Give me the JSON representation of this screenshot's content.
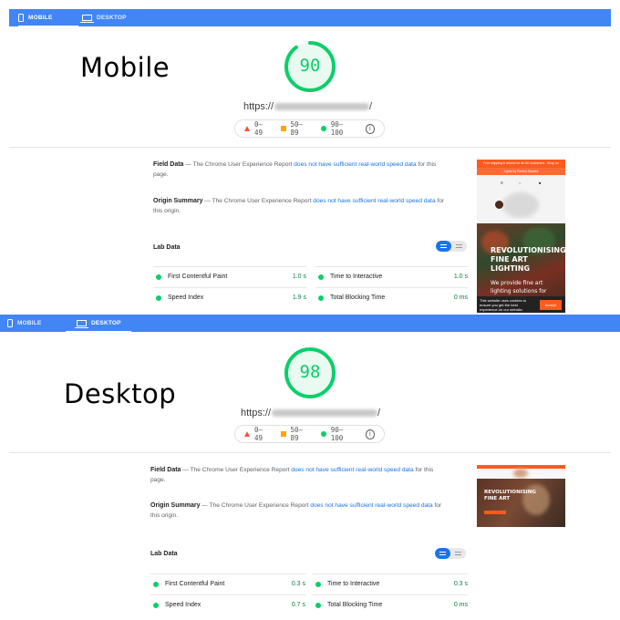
{
  "tabs": {
    "mobile": "MOBILE",
    "desktop": "DESKTOP"
  },
  "legend": {
    "low": "0–49",
    "mid": "50–89",
    "high": "90–100",
    "info_icon": "info-icon"
  },
  "colors": {
    "tab_bar": "#4285f4",
    "pass": "#0cce6b",
    "average": "#ffa400",
    "fail": "#ff4e42",
    "link": "#1a73e8",
    "brand_orange": "#ff5a1f"
  },
  "field_data": {
    "title": "Field Data",
    "text": " — The Chrome User Experience Report ",
    "link": "does not have sufficient real-world speed data",
    "tail": " for this page."
  },
  "origin_summary": {
    "title": "Origin Summary",
    "text": " — The Chrome User Experience Report ",
    "link": "does not have sufficient real-world speed data",
    "tail": " for this origin."
  },
  "lab_title": "Lab Data",
  "metric_names": {
    "fcp": "First Contentful Paint",
    "tti": "Time to Interactive",
    "si": "Speed Index",
    "tbt": "Total Blocking Time"
  },
  "mobile": {
    "label": "Mobile",
    "score": "90",
    "score_fraction": 0.9,
    "url_prefix": "https://",
    "url_suffix": "/",
    "metrics": {
      "fcp": "1.0 s",
      "tti": "1.0 s",
      "si": "1.9 s",
      "tbt": "0 ms"
    },
    "thumbnail": {
      "top_bar": "Free shipping & returns for all UK customers - Shop no",
      "sub_bar": "Lights by Perfect Shades",
      "headline": [
        "REVOLUTIONISING",
        "FINE ART",
        "LIGHTING"
      ],
      "subtext": [
        "We provide fine art",
        "lighting solutions for"
      ],
      "cookie": [
        "This website uses cookies to",
        "ensure you get the best",
        "experience on our website."
      ],
      "accept": "Accept"
    }
  },
  "desktop": {
    "label": "Desktop",
    "score": "98",
    "score_fraction": 0.98,
    "url_prefix": "https://",
    "url_suffix": "/",
    "metrics": {
      "fcp": "0.3 s",
      "tti": "0.3 s",
      "si": "0.7 s",
      "tbt": "0 ms"
    },
    "thumbnail": {
      "headline": [
        "REVOLUTIONISING",
        "FINE ART"
      ]
    }
  }
}
